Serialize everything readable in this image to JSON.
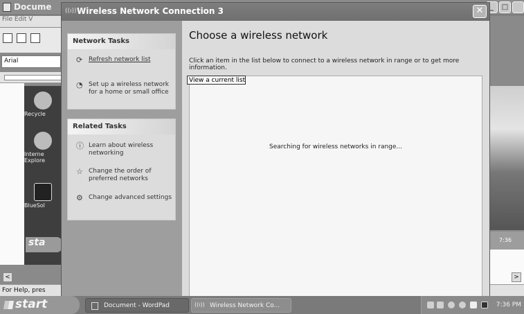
{
  "background": {
    "title": "Docume",
    "menu": "File  Edit  V",
    "font_name": "Arial",
    "status_text": "For Help, pres",
    "scroll_left": "<",
    "scroll_right": ">",
    "desktop_icons": [
      "Recycle",
      "Interne Explore",
      "BlueSol"
    ],
    "start_mini": "sta",
    "mini_clock": "7:36"
  },
  "window": {
    "title": "Wireless Network Connection 3",
    "icon": "wireless-signal-icon",
    "close": "✕",
    "network_tasks": {
      "header": "Network Tasks",
      "items": [
        {
          "icon": "refresh-icon",
          "label": "Refresh network list"
        },
        {
          "icon": "setup-network-icon",
          "label": "Set up a wireless network for a home or small office"
        }
      ]
    },
    "related_tasks": {
      "header": "Related Tasks",
      "items": [
        {
          "icon": "info-icon",
          "label": "Learn about wireless networking"
        },
        {
          "icon": "star-icon",
          "label": "Change the order of preferred networks"
        },
        {
          "icon": "settings-icon",
          "label": "Change advanced settings"
        }
      ]
    },
    "tooltip": "View a current list",
    "heading": "Choose a wireless network",
    "instruction": "Click an item in the list below to connect to a wireless network in range or to get more information.",
    "list_status": "Searching for wireless networks in range..."
  },
  "taskbar": {
    "start": "start",
    "buttons": [
      {
        "label": "Document - WordPad"
      },
      {
        "label": "Wireless Network Co..."
      }
    ],
    "clock": "7:36 PM"
  }
}
